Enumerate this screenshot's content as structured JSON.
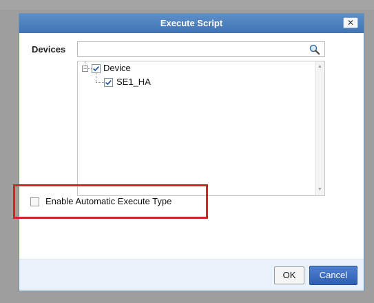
{
  "dialog": {
    "title": "Execute Script",
    "close_label": "✕"
  },
  "devices": {
    "label": "Devices",
    "search_placeholder": "",
    "search_value": "",
    "tree": [
      {
        "label": "Device",
        "checked": true,
        "expanded": true,
        "expander_symbol": "−"
      },
      {
        "label": "SE1_HA",
        "checked": true
      }
    ]
  },
  "options": {
    "enable_auto_execute_label": "Enable Automatic Execute Type",
    "enable_auto_execute_checked": false
  },
  "footer": {
    "ok_label": "OK",
    "cancel_label": "Cancel"
  },
  "colors": {
    "title_bar": "#4a7fc0",
    "cancel_button": "#3b69c0",
    "highlight_border": "#d3222a",
    "footer_bg": "#e9f2fb"
  }
}
